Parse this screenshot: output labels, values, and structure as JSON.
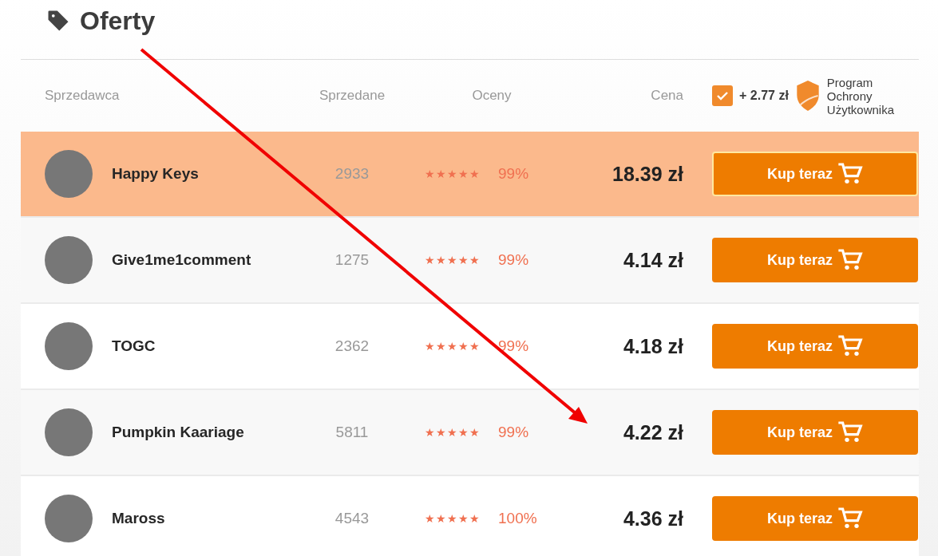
{
  "title": "Oferty",
  "columns": {
    "seller": "Sprzedawca",
    "sold": "Sprzedane",
    "ratings": "Oceny",
    "price": "Cena"
  },
  "protection": {
    "checked": true,
    "fee": "+ 2.77 zł",
    "label": "Program Ochrony Użytkownika"
  },
  "offers": [
    {
      "seller": "Happy Keys",
      "sold": "2933",
      "stars": 5,
      "rating": "99%",
      "price": "18.39 zł",
      "button": "Kup teraz",
      "selected": true
    },
    {
      "seller": "Give1me1comment",
      "sold": "1275",
      "stars": 5,
      "rating": "99%",
      "price": "4.14 zł",
      "button": "Kup teraz",
      "selected": false
    },
    {
      "seller": "TOGC",
      "sold": "2362",
      "stars": 5,
      "rating": "99%",
      "price": "4.18 zł",
      "button": "Kup teraz",
      "selected": false
    },
    {
      "seller": "Pumpkin Kaariage",
      "sold": "5811",
      "stars": 5,
      "rating": "99%",
      "price": "4.22 zł",
      "button": "Kup teraz",
      "selected": false
    },
    {
      "seller": "Maross",
      "sold": "4543",
      "stars": 5,
      "rating": "100%",
      "price": "4.36 zł",
      "button": "Kup teraz",
      "selected": false
    }
  ]
}
